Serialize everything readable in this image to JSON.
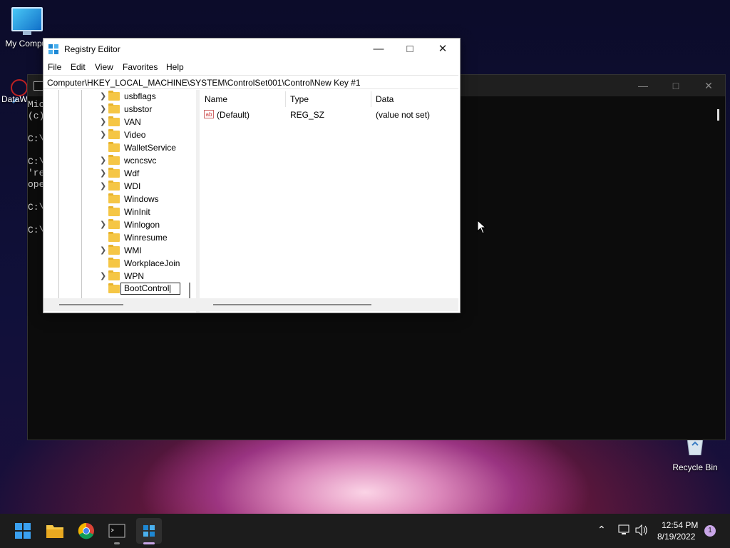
{
  "desktop": {
    "icons": [
      {
        "label": "My Comput"
      },
      {
        "label": "DataW"
      },
      {
        "label": "Recycle Bin"
      }
    ]
  },
  "cmd": {
    "lines": [
      "Mic",
      "(c)",
      "",
      "C:\\",
      "",
      "C:\\",
      "'re",
      "ope",
      "",
      "C:\\",
      "",
      "C:\\"
    ]
  },
  "regedit": {
    "title": "Registry Editor",
    "menu": [
      "File",
      "Edit",
      "View",
      "Favorites",
      "Help"
    ],
    "address": "Computer\\HKEY_LOCAL_MACHINE\\SYSTEM\\ControlSet001\\Control\\New Key #1",
    "tree": [
      {
        "label": "usbflags",
        "expandable": true
      },
      {
        "label": "usbstor",
        "expandable": true
      },
      {
        "label": "VAN",
        "expandable": true
      },
      {
        "label": "Video",
        "expandable": true
      },
      {
        "label": "WalletService",
        "expandable": false
      },
      {
        "label": "wcncsvc",
        "expandable": true
      },
      {
        "label": "Wdf",
        "expandable": true
      },
      {
        "label": "WDI",
        "expandable": true
      },
      {
        "label": "Windows",
        "expandable": false
      },
      {
        "label": "WinInit",
        "expandable": false
      },
      {
        "label": "Winlogon",
        "expandable": true
      },
      {
        "label": "Winresume",
        "expandable": false
      },
      {
        "label": "WMI",
        "expandable": true
      },
      {
        "label": "WorkplaceJoin",
        "expandable": false
      },
      {
        "label": "WPN",
        "expandable": true
      }
    ],
    "rename_value": "BootControl",
    "columns": {
      "name": "Name",
      "type": "Type",
      "data": "Data"
    },
    "values": [
      {
        "name": "(Default)",
        "type": "REG_SZ",
        "data": "(value not set)"
      }
    ]
  },
  "taskbar": {
    "time": "12:54 PM",
    "date": "8/19/2022",
    "notification_count": "1"
  }
}
